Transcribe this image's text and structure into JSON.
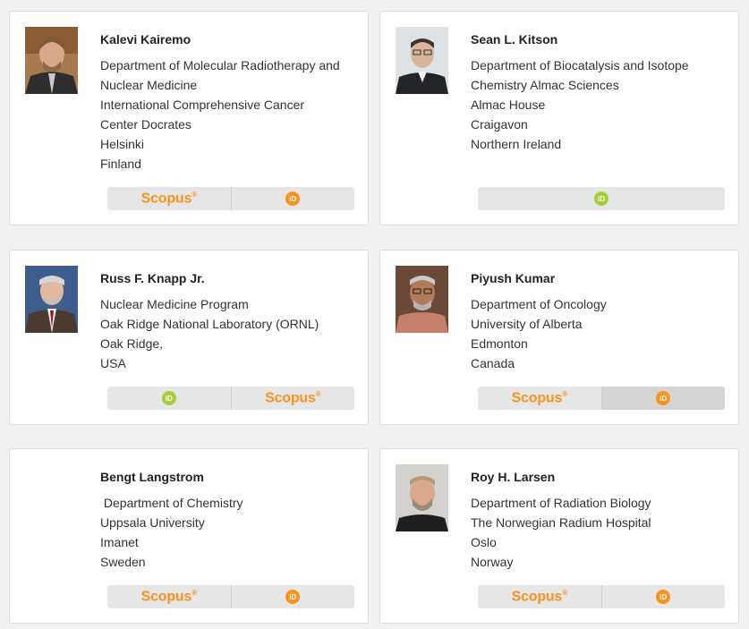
{
  "researchers": [
    {
      "name": "Kalevi Kairemo",
      "affiliation": [
        "Department of Molecular Radiotherapy and",
        "Nuclear Medicine",
        "International Comprehensive Cancer",
        "Center Docrates",
        "Helsinki",
        "Finland"
      ],
      "links": [
        {
          "type": "scopus",
          "label": "Scopus",
          "mark": "®"
        },
        {
          "type": "researcherid",
          "label": "iD"
        }
      ]
    },
    {
      "name": "Sean L. Kitson",
      "affiliation": [
        "Department of Biocatalysis and Isotope",
        "Chemistry Almac Sciences",
        "Almac House",
        "Craigavon",
        "Northern Ireland"
      ],
      "links": [
        {
          "type": "orcid",
          "label": "iD"
        }
      ]
    },
    {
      "name": "Russ F. Knapp Jr.",
      "affiliation": [
        "Nuclear Medicine Program",
        "Oak Ridge National Laboratory (ORNL)",
        "Oak Ridge,",
        "USA"
      ],
      "links": [
        {
          "type": "orcid",
          "label": "iD"
        },
        {
          "type": "scopus",
          "label": "Scopus",
          "mark": "®"
        }
      ]
    },
    {
      "name": "Piyush Kumar",
      "affiliation": [
        "Department of Oncology",
        "University of Alberta",
        "Edmonton",
        "Canada"
      ],
      "links": [
        {
          "type": "scopus",
          "label": "Scopus",
          "mark": "®"
        },
        {
          "type": "researcherid",
          "label": "iD"
        }
      ]
    },
    {
      "name": "Bengt Langstrom",
      "affiliation": [
        " Department of Chemistry",
        "Uppsala University",
        "Imanet",
        "Sweden"
      ],
      "links": [
        {
          "type": "scopus",
          "label": "Scopus",
          "mark": "®"
        },
        {
          "type": "researcherid",
          "label": "iD"
        }
      ]
    },
    {
      "name": "Roy H. Larsen",
      "affiliation": [
        "Department of Radiation Biology",
        "The Norwegian Radium Hospital",
        "Oslo",
        "Norway"
      ],
      "links": [
        {
          "type": "scopus",
          "label": "Scopus",
          "mark": "®"
        },
        {
          "type": "researcherid",
          "label": "iD"
        }
      ]
    }
  ],
  "colors": {
    "scopus": "#f7931e",
    "orcid": "#a6ce39",
    "researcherid": "#f7931e"
  }
}
